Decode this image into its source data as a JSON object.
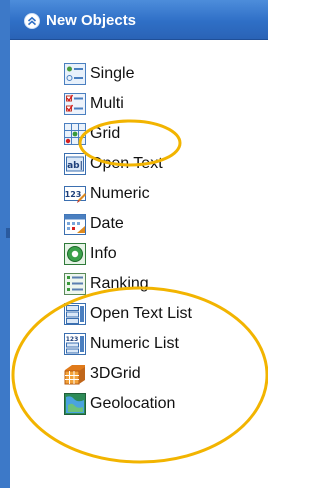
{
  "panel": {
    "title": "New Objects",
    "collapse_icon": "double-chevron-up-icon"
  },
  "items": [
    {
      "label": "Single",
      "icon": "single-choice-icon"
    },
    {
      "label": "Multi",
      "icon": "multi-choice-icon"
    },
    {
      "label": "Grid",
      "icon": "grid-question-icon"
    },
    {
      "label": "Open Text",
      "icon": "open-text-icon"
    },
    {
      "label": "Numeric",
      "icon": "numeric-icon"
    },
    {
      "label": "Date",
      "icon": "date-icon"
    },
    {
      "label": "Info",
      "icon": "info-icon"
    },
    {
      "label": "Ranking",
      "icon": "ranking-icon"
    },
    {
      "label": "Open Text List",
      "icon": "open-text-list-icon"
    },
    {
      "label": "Numeric List",
      "icon": "numeric-list-icon"
    },
    {
      "label": "3DGrid",
      "icon": "3d-grid-icon"
    },
    {
      "label": "Geolocation",
      "icon": "geolocation-icon"
    }
  ],
  "annotations": {
    "color": "#f2b400",
    "highlighted_items": [
      "Grid",
      "Ranking",
      "Open Text List",
      "Numeric List",
      "3DGrid",
      "Geolocation"
    ]
  }
}
